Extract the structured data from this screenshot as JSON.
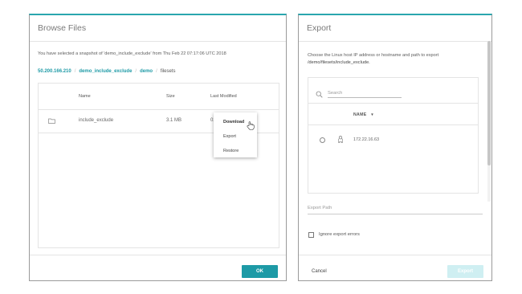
{
  "browse_dialog": {
    "title": "Browse Files",
    "snapshot_text": "You have selected a snapshot of 'demo_include_exclude' from Thu Feb 22 07:17:06 UTC 2018",
    "breadcrumb": [
      "50.200.166.210",
      "demo_include_exclude",
      "demo",
      "filesets"
    ],
    "table": {
      "headers": {
        "name": "Name",
        "size": "Size",
        "last_modified": "Last Modified"
      },
      "rows": [
        {
          "icon": "folder-icon",
          "name": "include_exclude",
          "size": "3.1 MB",
          "last_modified": "02/22"
        }
      ]
    },
    "context_menu": {
      "items": [
        "Download",
        "Export",
        "Restore"
      ]
    },
    "ok_label": "OK",
    "accent_color": "#1d9aa6"
  },
  "export_dialog": {
    "title": "Export",
    "description": "Choose the Linux host IP address or hostname and path to export",
    "description_path": "/demo/filesets/include_exclude.",
    "search_placeholder": "Search",
    "column_header": "NAME",
    "sort_indicator": "▼",
    "hosts": [
      {
        "icon": "linux-icon",
        "ip": "172.22.16.63",
        "selected": false
      }
    ],
    "path_placeholder": "Export Path",
    "ignore_errors_label": "Ignore export errors",
    "ignore_errors_checked": false,
    "cancel_label": "Cancel",
    "export_label": "Export",
    "export_enabled": false
  }
}
